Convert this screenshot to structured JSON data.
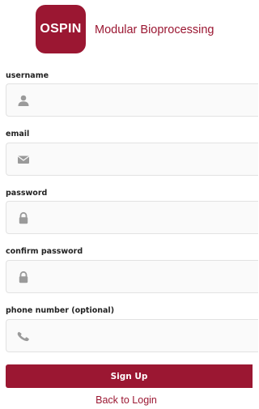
{
  "header": {
    "logo_text": "OSPIN",
    "tagline": "Modular Bioprocessing",
    "brand_color": "#9b1732"
  },
  "form": {
    "fields": [
      {
        "label": "username",
        "icon": "user-icon",
        "value": "",
        "placeholder": ""
      },
      {
        "label": "email",
        "icon": "envelope-icon",
        "value": "",
        "placeholder": ""
      },
      {
        "label": "password",
        "icon": "lock-icon",
        "value": "",
        "placeholder": ""
      },
      {
        "label": "confirm password",
        "icon": "lock-icon",
        "value": "",
        "placeholder": ""
      },
      {
        "label": "phone number (optional)",
        "icon": "phone-icon",
        "value": "",
        "placeholder": ""
      }
    ],
    "submit_label": "Sign Up",
    "back_link_label": "Back to Login"
  },
  "colors": {
    "accent": "#9b1732",
    "field_background": "#fafafa",
    "icon_gray": "#9a9a9a"
  }
}
